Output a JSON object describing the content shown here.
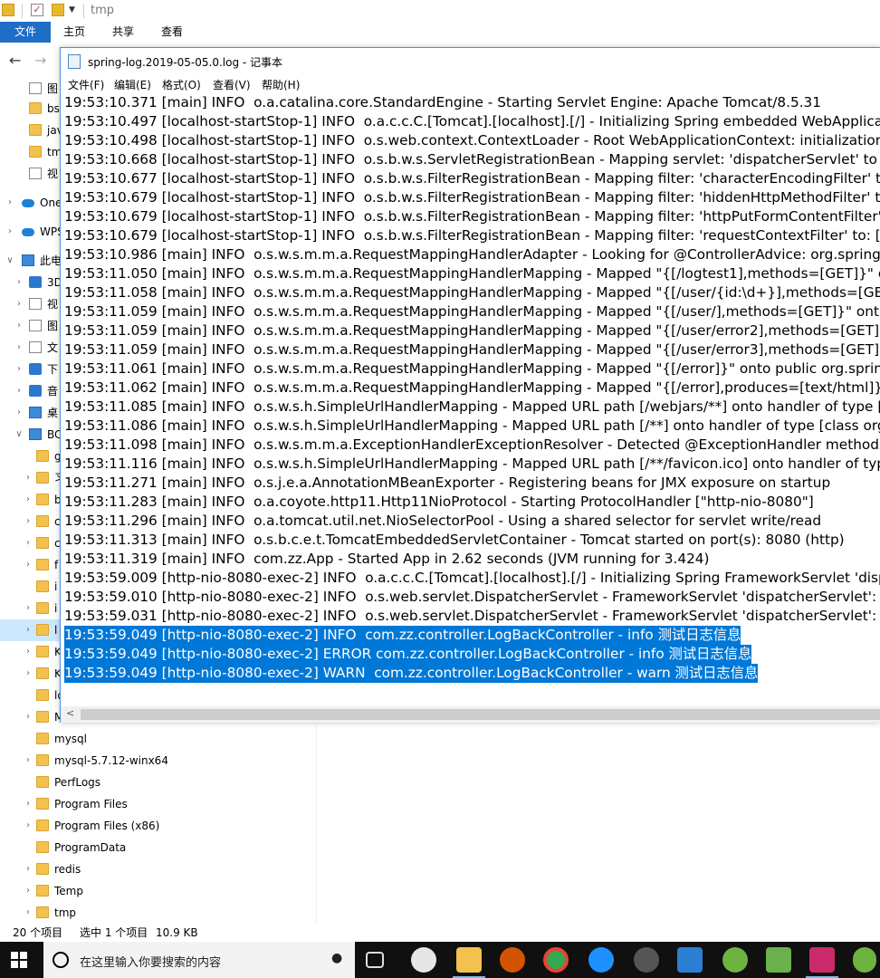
{
  "explorer": {
    "title": "tmp",
    "ribbon_tabs": [
      "文件",
      "主页",
      "共享",
      "查看"
    ],
    "nav_items": [
      {
        "label": "图",
        "icon": "pictures-icon"
      },
      {
        "label": "bs",
        "icon": "folder-icon"
      },
      {
        "label": "jav",
        "icon": "folder-icon"
      },
      {
        "label": "tm",
        "icon": "folder-icon"
      },
      {
        "label": "视",
        "icon": "videos-icon"
      },
      {
        "label": "One",
        "icon": "onedrive-icon"
      },
      {
        "label": "WPS",
        "icon": "wps-cloud-icon"
      },
      {
        "label": "此电",
        "icon": "this-pc-icon"
      },
      {
        "label": "3D",
        "icon": "3d-objects-icon"
      },
      {
        "label": "视",
        "icon": "videos-icon"
      },
      {
        "label": "图",
        "icon": "pictures-icon"
      },
      {
        "label": "文",
        "icon": "documents-icon"
      },
      {
        "label": "下",
        "icon": "downloads-icon"
      },
      {
        "label": "音",
        "icon": "music-icon"
      },
      {
        "label": "桌",
        "icon": "desktop-icon"
      },
      {
        "label": "BC",
        "icon": "drive-icon"
      },
      {
        "label": "g",
        "icon": "folder-icon"
      },
      {
        "label": "习",
        "icon": "folder-icon"
      },
      {
        "label": "b",
        "icon": "folder-icon"
      },
      {
        "label": "c",
        "icon": "folder-icon"
      },
      {
        "label": "c",
        "icon": "folder-icon"
      },
      {
        "label": "f",
        "icon": "folder-icon"
      },
      {
        "label": "i",
        "icon": "folder-icon"
      },
      {
        "label": "i",
        "icon": "folder-icon"
      },
      {
        "label": "l",
        "icon": "folder-icon"
      },
      {
        "label": "K",
        "icon": "folder-icon"
      },
      {
        "label": "K",
        "icon": "folder-icon"
      },
      {
        "label": "lo",
        "icon": "folder-icon"
      },
      {
        "label": "M",
        "icon": "folder-icon"
      },
      {
        "label": "mysql",
        "icon": "folder-icon"
      },
      {
        "label": "mysql-5.7.12-winx64",
        "icon": "folder-icon"
      },
      {
        "label": "PerfLogs",
        "icon": "folder-icon"
      },
      {
        "label": "Program Files",
        "icon": "folder-icon"
      },
      {
        "label": "Program Files (x86)",
        "icon": "folder-icon"
      },
      {
        "label": "ProgramData",
        "icon": "folder-icon"
      },
      {
        "label": "redis",
        "icon": "folder-icon"
      },
      {
        "label": "Temp",
        "icon": "folder-icon"
      },
      {
        "label": "tmp",
        "icon": "folder-icon"
      }
    ],
    "status": {
      "item_count": "20 个项目",
      "selected": "选中 1 个项目",
      "size": "10.9 KB"
    }
  },
  "notepad": {
    "title": "spring-log.2019-05-05.0.log - 记事本",
    "menu": [
      "文件(F)",
      "编辑(E)",
      "格式(O)",
      "查看(V)",
      "帮助(H)"
    ],
    "lines": [
      "19:53:10.371 [main] INFO  o.a.catalina.core.StandardEngine - Starting Servlet Engine: Apache Tomcat/8.5.31",
      "19:53:10.497 [localhost-startStop-1] INFO  o.a.c.c.C.[Tomcat].[localhost].[/] - Initializing Spring embedded WebApplicati",
      "19:53:10.498 [localhost-startStop-1] INFO  o.s.web.context.ContextLoader - Root WebApplicationContext: initialization",
      "19:53:10.668 [localhost-startStop-1] INFO  o.s.b.w.s.ServletRegistrationBean - Mapping servlet: 'dispatcherServlet' to [/]",
      "19:53:10.677 [localhost-startStop-1] INFO  o.s.b.w.s.FilterRegistrationBean - Mapping filter: 'characterEncodingFilter' to",
      "19:53:10.679 [localhost-startStop-1] INFO  o.s.b.w.s.FilterRegistrationBean - Mapping filter: 'hiddenHttpMethodFilter' to",
      "19:53:10.679 [localhost-startStop-1] INFO  o.s.b.w.s.FilterRegistrationBean - Mapping filter: 'httpPutFormContentFilter'",
      "19:53:10.679 [localhost-startStop-1] INFO  o.s.b.w.s.FilterRegistrationBean - Mapping filter: 'requestContextFilter' to: [/*",
      "19:53:10.986 [main] INFO  o.s.w.s.m.m.a.RequestMappingHandlerAdapter - Looking for @ControllerAdvice: org.springf",
      "19:53:11.050 [main] INFO  o.s.w.s.m.m.a.RequestMappingHandlerMapping - Mapped \"{[/logtest1],methods=[GET]}\" ont",
      "19:53:11.058 [main] INFO  o.s.w.s.m.m.a.RequestMappingHandlerMapping - Mapped \"{[/user/{id:\\d+}],methods=[GET]}",
      "19:53:11.059 [main] INFO  o.s.w.s.m.m.a.RequestMappingHandlerMapping - Mapped \"{[/user/],methods=[GET]}\" onto p",
      "19:53:11.059 [main] INFO  o.s.w.s.m.m.a.RequestMappingHandlerMapping - Mapped \"{[/user/error2],methods=[GET]}\"",
      "19:53:11.059 [main] INFO  o.s.w.s.m.m.a.RequestMappingHandlerMapping - Mapped \"{[/user/error3],methods=[GET]}\"",
      "19:53:11.061 [main] INFO  o.s.w.s.m.m.a.RequestMappingHandlerMapping - Mapped \"{[/error]}\" onto public org.spring",
      "19:53:11.062 [main] INFO  o.s.w.s.m.m.a.RequestMappingHandlerMapping - Mapped \"{[/error],produces=[text/html]}\" o",
      "19:53:11.085 [main] INFO  o.s.w.s.h.SimpleUrlHandlerMapping - Mapped URL path [/webjars/**] onto handler of type [",
      "19:53:11.086 [main] INFO  o.s.w.s.h.SimpleUrlHandlerMapping - Mapped URL path [/**] onto handler of type [class org",
      "19:53:11.098 [main] INFO  o.s.w.s.m.m.a.ExceptionHandlerExceptionResolver - Detected @ExceptionHandler methods in",
      "19:53:11.116 [main] INFO  o.s.w.s.h.SimpleUrlHandlerMapping - Mapped URL path [/**/favicon.ico] onto handler of typ",
      "19:53:11.271 [main] INFO  o.s.j.e.a.AnnotationMBeanExporter - Registering beans for JMX exposure on startup",
      "19:53:11.283 [main] INFO  o.a.coyote.http11.Http11NioProtocol - Starting ProtocolHandler [\"http-nio-8080\"]",
      "19:53:11.296 [main] INFO  o.a.tomcat.util.net.NioSelectorPool - Using a shared selector for servlet write/read",
      "19:53:11.313 [main] INFO  o.s.b.c.e.t.TomcatEmbeddedServletContainer - Tomcat started on port(s): 8080 (http)",
      "19:53:11.319 [main] INFO  com.zz.App - Started App in 2.62 seconds (JVM running for 3.424)",
      "19:53:59.009 [http-nio-8080-exec-2] INFO  o.a.c.c.C.[Tomcat].[localhost].[/] - Initializing Spring FrameworkServlet 'dispa",
      "19:53:59.010 [http-nio-8080-exec-2] INFO  o.s.web.servlet.DispatcherServlet - FrameworkServlet 'dispatcherServlet': init",
      "19:53:59.031 [http-nio-8080-exec-2] INFO  o.s.web.servlet.DispatcherServlet - FrameworkServlet 'dispatcherServlet': init",
      "19:53:59.049 [http-nio-8080-exec-2] INFO  com.zz.controller.LogBackController - info 测试日志信息",
      "19:53:59.049 [http-nio-8080-exec-2] ERROR com.zz.controller.LogBackController - info 测试日志信息",
      "19:53:59.049 [http-nio-8080-exec-2] WARN  com.zz.controller.LogBackController - warn 测试日志信息"
    ],
    "selected_line_indices": [
      28,
      29,
      30
    ]
  },
  "taskbar": {
    "search_placeholder": "在这里输入你要搜索的内容",
    "apps": [
      "task-view-icon",
      "app-icon",
      "file-explorer-icon",
      "app-icon",
      "chrome-icon",
      "edge-icon",
      "app-icon",
      "vscode-icon",
      "spring-icon",
      "app-icon",
      "intellij-icon",
      "spring-icon"
    ]
  },
  "colors": {
    "accent": "#1e6ec8",
    "selection": "#0078d7",
    "taskbar": "#101010"
  }
}
